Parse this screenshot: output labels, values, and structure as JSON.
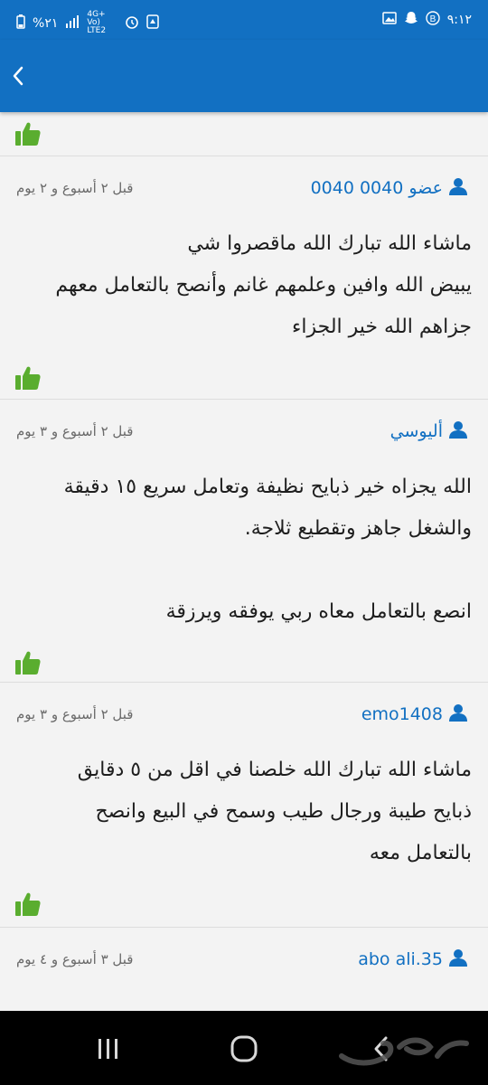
{
  "status_bar": {
    "time": "٩:١٢",
    "battery": "%٢١",
    "network": "4G+ Vo) LTE2"
  },
  "app_bar": {
    "back_icon": "chevron-left-icon"
  },
  "comments": [
    {
      "author": "عضو 0040 0040",
      "date": "قبل ٢ أسبوع و ٢ يوم",
      "lines": [
        "ماشاء الله تبارك الله ماقصروا شي",
        "يبيض الله وافين وعلمهم غانم وأنصح بالتعامل معهم",
        "جزاهم الله خير الجزاء"
      ]
    },
    {
      "author": "أليوسي",
      "date": "قبل ٢ أسبوع و ٣ يوم",
      "lines": [
        "الله يجزاه خير ذبايح نظيفة وتعامل سريع ١٥ دقيقة",
        "والشغل جاهز وتقطيع ثلاجة.",
        "",
        "انصع بالتعامل معاه ربي يوفقه ويرزقة"
      ]
    },
    {
      "author": "emo1408",
      "date": "قبل ٢ أسبوع و ٣ يوم",
      "lines": [
        "ماشاء الله تبارك الله خلصنا في اقل من ٥ دقايق",
        "ذبايح طيبة ورجال طيب وسمح في البيع وانصح",
        "بالتعامل معه"
      ]
    },
    {
      "author": "abo ali.35",
      "date": "قبل ٣ أسبوع و ٤ يوم",
      "lines": []
    }
  ],
  "colors": {
    "accent": "#1270c2",
    "thumb": "#5aad2f",
    "background": "#f3f3f3"
  },
  "nav_bar": {
    "icons": [
      "recent-apps-icon",
      "home-icon",
      "back-icon"
    ]
  },
  "watermark": "حراج"
}
